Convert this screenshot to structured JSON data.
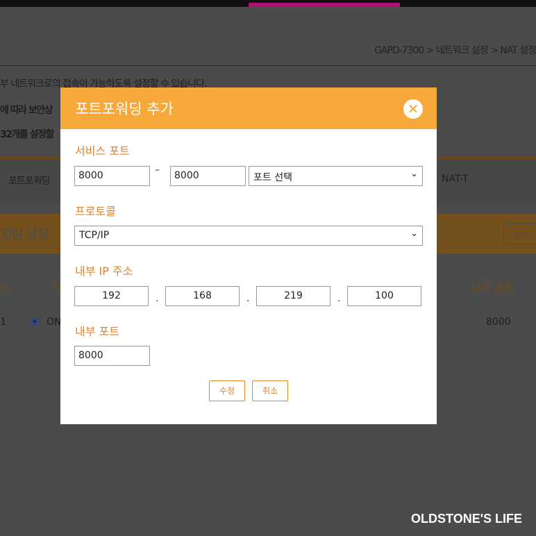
{
  "background": {
    "breadcrumb": "GAPD-7300 > 네트워크 설정 > NAT 설정",
    "desc1": "부 네트워크로의 접속이 가능하도록 설정할 수 있습니다.",
    "desc2": "에 따라 보안상",
    "desc3": "32개를 설정할",
    "tab1": "포트포워딩",
    "tab2": "NAT-T",
    "section_title": "워딩 설정",
    "add_label": "추가",
    "col_no": "o.",
    "col_onoff": "O",
    "col_inner_port": "내부 포트",
    "row_no": "1",
    "row_onoff": "ON",
    "row_inner_port": "8000"
  },
  "watermark": "OLDSTONE'S LIFE",
  "modal": {
    "title": "포트포워딩 추가",
    "close_icon": "close-icon",
    "service_port_label": "서비스 포트",
    "service_port_start": "8000",
    "dash": "–",
    "service_port_end": "8000",
    "port_select": "포트 선택",
    "protocol_label": "프로토콜",
    "protocol": "TCP/IP",
    "ip_label": "내부 IP 주소",
    "ip": [
      "192",
      "168",
      "219",
      "100"
    ],
    "dot": ".",
    "inner_port_label": "내부 포트",
    "inner_port": "8000",
    "save": "수정",
    "cancel": "취소"
  },
  "colors": {
    "accent": "#f7a83b",
    "label": "#e4822a"
  }
}
